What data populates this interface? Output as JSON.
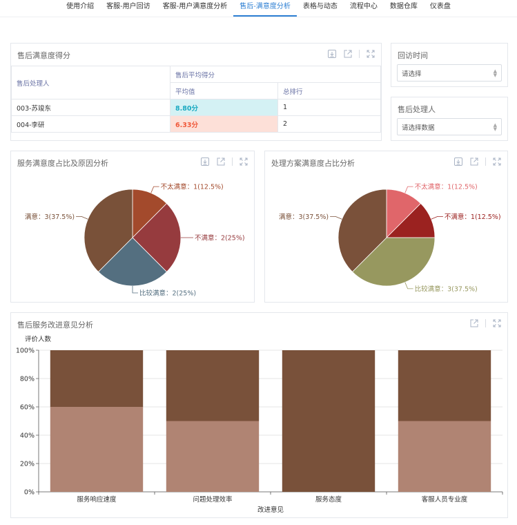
{
  "nav": {
    "items": [
      {
        "label": "使用介绍"
      },
      {
        "label": "客服-用户回访"
      },
      {
        "label": "客服-用户满意度分析"
      },
      {
        "label": "售后-满意度分析",
        "active": true
      },
      {
        "label": "表格与动态"
      },
      {
        "label": "流程中心"
      },
      {
        "label": "数据仓库"
      },
      {
        "label": "仪表盘"
      }
    ]
  },
  "score_panel": {
    "title": "售后满意度得分",
    "headers": {
      "handler": "售后处理人",
      "group": "售后平均得分",
      "avg": "平均值",
      "rank": "总排行"
    },
    "rows": [
      {
        "name": "003-苏竣东",
        "avg": "8.80分",
        "rank": "1"
      },
      {
        "name": "004-李研",
        "avg": "6.33分",
        "rank": "2"
      }
    ]
  },
  "filters": {
    "time": {
      "label": "回访时间",
      "placeholder": "请选择"
    },
    "handler": {
      "label": "售后处理人",
      "placeholder": "请选择数据"
    }
  },
  "pie1": {
    "title": "服务满意度占比及原因分析"
  },
  "pie2": {
    "title": "处理方案满意度占比分析"
  },
  "bar_panel": {
    "title": "售后服务改进意见分析"
  },
  "icons": [
    "download-icon",
    "export-icon",
    "fullscreen-icon"
  ],
  "chart_data": [
    {
      "type": "pie",
      "title": "服务满意度占比及原因分析",
      "slices": [
        {
          "name": "不太满意",
          "value": 1,
          "label": "不太满意：1(12.5%)",
          "color": "#a34a2c"
        },
        {
          "name": "不满意",
          "value": 2,
          "label": "不满意：2(25%)",
          "color": "#963b3e"
        },
        {
          "name": "比较满意",
          "value": 2,
          "label": "比较满意：2(25%)",
          "color": "#546f80"
        },
        {
          "name": "满意",
          "value": 3,
          "label": "满意：3(37.5%)",
          "color": "#795139"
        }
      ]
    },
    {
      "type": "pie",
      "title": "处理方案满意度占比分析",
      "slices": [
        {
          "name": "不太满意",
          "value": 1,
          "label": "不太满意：1(12.5%)",
          "color": "#e0666a"
        },
        {
          "name": "不满意",
          "value": 1,
          "label": "不满意：1(12.5%)",
          "color": "#9b2220"
        },
        {
          "name": "比较满意",
          "value": 3,
          "label": "比较满意：3(37.5%)",
          "color": "#97985f"
        },
        {
          "name": "满意",
          "value": 3,
          "label": "满意：3(37.5%)",
          "color": "#7a513a"
        }
      ]
    },
    {
      "type": "bar",
      "stacked": true,
      "percent": true,
      "title": "售后服务改进意见分析",
      "ylabel": "评价人数",
      "xlabel": "改进意见",
      "ylim": [
        0,
        100
      ],
      "yticks": [
        "0%",
        "20%",
        "40%",
        "60%",
        "80%",
        "100%"
      ],
      "categories": [
        "服务响应速度",
        "问题处理效率",
        "服务态度",
        "客服人员专业度"
      ],
      "series": [
        {
          "values": [
            60,
            50,
            0,
            50
          ],
          "color": "#b08473"
        },
        {
          "values": [
            40,
            50,
            100,
            50
          ],
          "color": "#79513a"
        }
      ]
    }
  ]
}
